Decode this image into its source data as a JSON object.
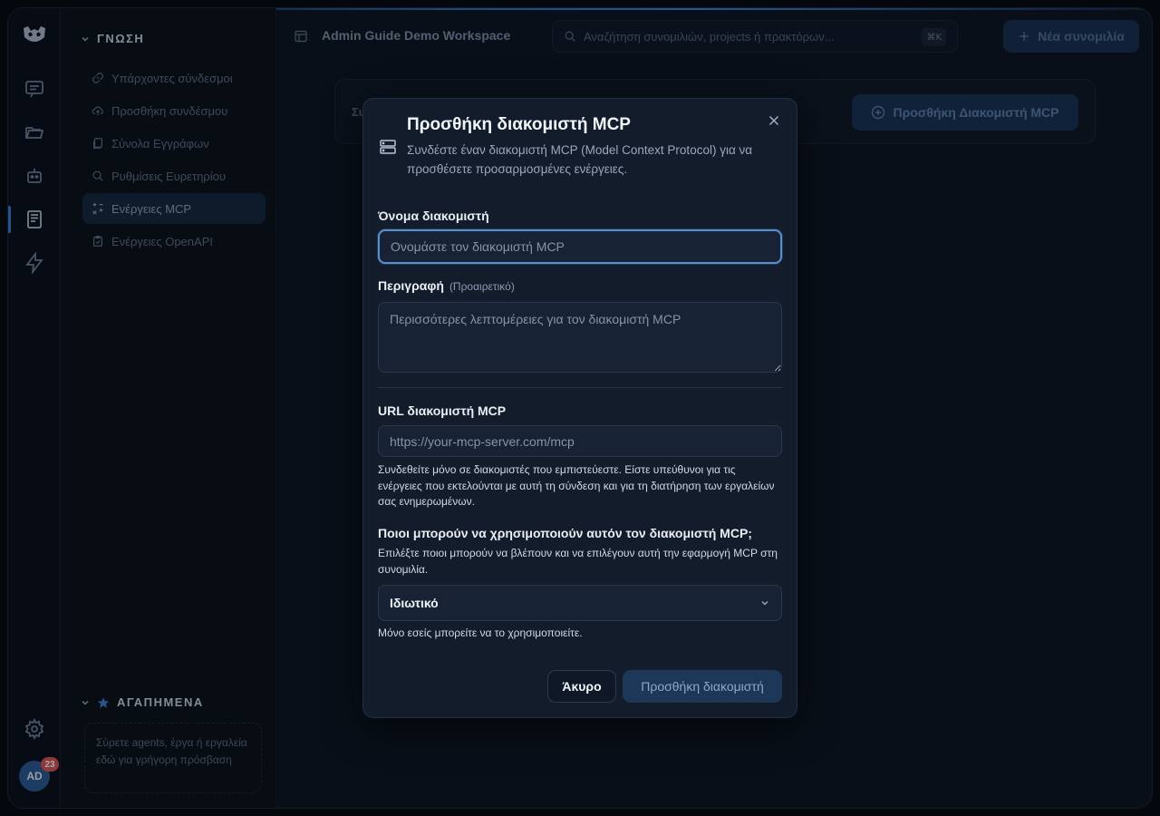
{
  "header": {
    "workspace_title": "Admin Guide Demo Workspace",
    "search_placeholder": "Αναζήτηση συνομιλιών, projects ή πρακτόρων...",
    "search_shortcut": "⌘K",
    "new_chat_label": "Νέα συνομιλία"
  },
  "sidebar": {
    "knowledge_title": "ΓΝΩΣΗ",
    "items": [
      {
        "label": "Υπάρχοντες σύνδεσμοι"
      },
      {
        "label": "Προσθήκη συνδέσμου"
      },
      {
        "label": "Σύνολα Εγγράφων"
      },
      {
        "label": "Ρυθμίσεις Ευρετηρίου"
      },
      {
        "label": "Ενέργειες MCP"
      },
      {
        "label": "Ενέργειες OpenAPI"
      }
    ],
    "favorites_title": "ΑΓΑΠΗΜΕΝΑ",
    "favorites_hint": "Σύρετε agents, έργα ή εργαλεία εδώ για γρήγορη πρόσβαση"
  },
  "user": {
    "initials": "AD",
    "notification_count": "23"
  },
  "background_card": {
    "label": "Συ",
    "button_label": "Προσθήκη Διακομιστή MCP"
  },
  "modal": {
    "title": "Προσθήκη διακομιστή MCP",
    "subtitle": "Συνδέστε έναν διακομιστή MCP (Model Context Protocol) για να προσθέσετε προσαρμοσμένες ενέργειες.",
    "name_label": "Όνομα διακομιστή",
    "name_placeholder": "Ονομάστε τον διακομιστή MCP",
    "description_label": "Περιγραφή",
    "description_optional": "(Προαιρετικό)",
    "description_placeholder": "Περισσότερες λεπτομέρειες για τον διακομιστή MCP",
    "url_label": "URL διακομιστή MCP",
    "url_placeholder": "https://your-mcp-server.com/mcp",
    "url_help": "Συνδεθείτε μόνο σε διακομιστές που εμπιστεύεστε. Είστε υπεύθυνοι για τις ενέργειες που εκτελούνται με αυτή τη σύνδεση και για τη διατήρηση των εργαλείων σας ενημερωμένων.",
    "access_label": "Ποιοι μπορούν να χρησιμοποιούν αυτόν τον διακομιστή MCP;",
    "access_help": "Επιλέξτε ποιοι μπορούν να βλέπουν και να επιλέγουν αυτή την εφαρμογή MCP στη συνομιλία.",
    "access_value": "Ιδιωτικό",
    "access_note": "Μόνο εσείς μπορείτε να το χρησιμοποιείτε.",
    "cancel_label": "Άκυρο",
    "submit_label": "Προσθήκη διακομιστή"
  }
}
